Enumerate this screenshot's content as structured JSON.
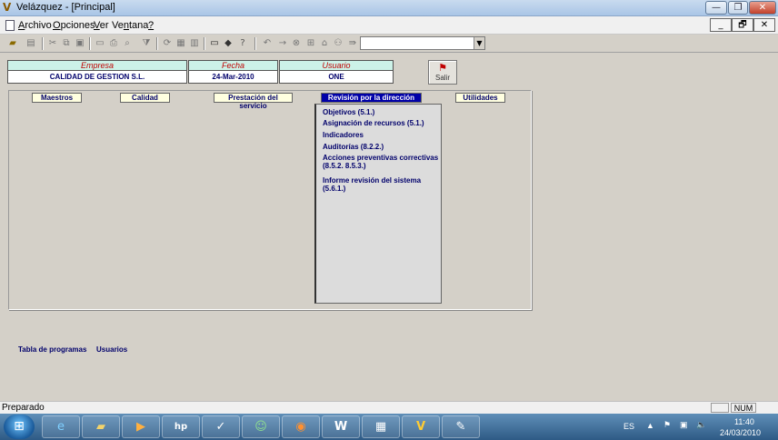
{
  "window": {
    "title": "Velázquez - [Principal]",
    "minimize_glyph": "—",
    "restore_glyph": "❐",
    "close_glyph": "✕"
  },
  "menu": {
    "items": [
      {
        "label": "Archivo",
        "accel": "A",
        "rest": "rchivo"
      },
      {
        "label": "Opciones",
        "accel": "O",
        "rest": "pciones"
      },
      {
        "label": "Ver",
        "accel": "V",
        "rest": "er"
      },
      {
        "label": "Ventana",
        "pre": "Ve",
        "accel": "n",
        "rest": "tana"
      },
      {
        "label": "?",
        "accel": "?",
        "rest": ""
      }
    ],
    "mdi_minimize": "_",
    "mdi_restore": "🗗",
    "mdi_close": "✕"
  },
  "toolbar": {
    "icons": [
      "open-icon",
      "preview-icon",
      "cut-icon",
      "copy-icon",
      "paste-icon",
      "form-icon",
      "print-icon",
      "find-icon",
      "filter-icon",
      "refresh-icon",
      "report-icon",
      "grid-icon",
      "monitor-icon",
      "diamond-icon",
      "help-icon",
      "undo-icon",
      "redo-icon",
      "stop-icon",
      "tree-icon",
      "home-icon",
      "group-icon",
      "run-icon"
    ],
    "combo_value": ""
  },
  "header": {
    "empresa_label": "Empresa",
    "empresa_value": "CALIDAD DE GESTION S.L.",
    "fecha_label": "Fecha",
    "fecha_value": "24-Mar-2010",
    "usuario_label": "Usuario",
    "usuario_value": "ONE",
    "salir_label": "Salir"
  },
  "tabs": [
    {
      "label": "Maestros"
    },
    {
      "label": "Calidad"
    },
    {
      "label": "Prestación del servicio"
    },
    {
      "label": "Revisión por la dirección",
      "active": true
    },
    {
      "label": "Utilidades"
    }
  ],
  "submenu": {
    "items": [
      {
        "label": "Objetivos (5.1.)"
      },
      {
        "label": "Asignación de recursos (5.1.)"
      },
      {
        "label": "Indicadores"
      },
      {
        "label": "Auditorías (8.2.2.)"
      },
      {
        "label": "Acciones preventivas correctivas",
        "label2": "(8.5.2. 8.5.3.)"
      },
      {
        "label": "Informe revisión del sistema (5.6.1.)"
      }
    ]
  },
  "bottom_links": {
    "programs": "Tabla de programas",
    "users": "Usuarios"
  },
  "status": {
    "text": "Preparado",
    "num": "NUM"
  },
  "taskbar": {
    "language": "ES",
    "time": "11:40",
    "date": "24/03/2010",
    "apps": [
      "ie-icon",
      "explorer-icon",
      "media-player-icon",
      "hp-icon",
      "monitor-app-icon",
      "messenger-icon",
      "firefox-icon",
      "word-icon",
      "calculator-icon",
      "velazquez-icon",
      "paint-icon"
    ]
  }
}
